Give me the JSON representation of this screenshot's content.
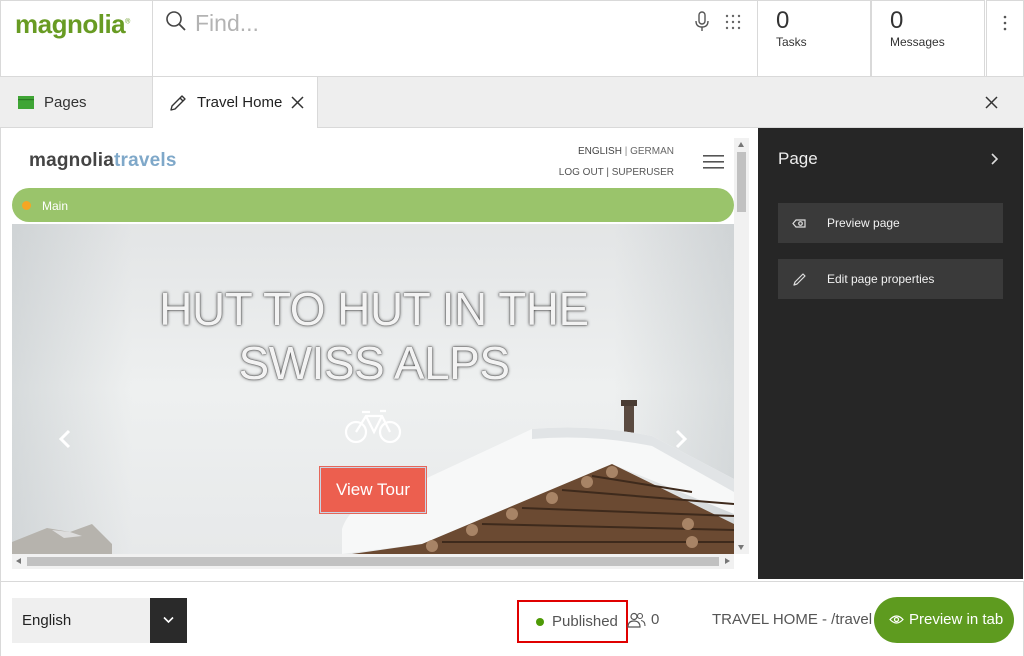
{
  "app": {
    "logo_text": "magnolia"
  },
  "search": {
    "placeholder": "Find..."
  },
  "counters": {
    "tasks": {
      "count": "0",
      "label": "Tasks"
    },
    "messages": {
      "count": "0",
      "label": "Messages"
    }
  },
  "tabs": {
    "pages_label": "Pages",
    "travel_label": "Travel Home"
  },
  "site": {
    "logo_part1": "magnolia",
    "logo_part2": "travels",
    "lang_current": "ENGLISH",
    "lang_sep": "|",
    "lang_other": "GERMAN",
    "login_line": "LOG OUT | SUPERUSER",
    "area_label": "Main",
    "hero_line1": "HUT TO HUT IN THE",
    "hero_line2": "SWISS ALPS",
    "cta_label": "View Tour"
  },
  "panel": {
    "title": "Page",
    "actions": [
      {
        "label": "Preview page",
        "icon": "eye-tag-icon"
      },
      {
        "label": "Edit page properties",
        "icon": "pencil-icon"
      }
    ]
  },
  "footer": {
    "language": "English",
    "status": "Published",
    "users_count": "0",
    "page_path": "TRAVEL HOME - /travel",
    "preview_button": "Preview in tab"
  },
  "colors": {
    "brand_green": "#689b23",
    "area_green": "#9ac46b",
    "cta_red": "#ec5f4f",
    "panel_dark": "#262626",
    "published_dot": "#4e9a06",
    "highlight_red": "#e00000"
  }
}
